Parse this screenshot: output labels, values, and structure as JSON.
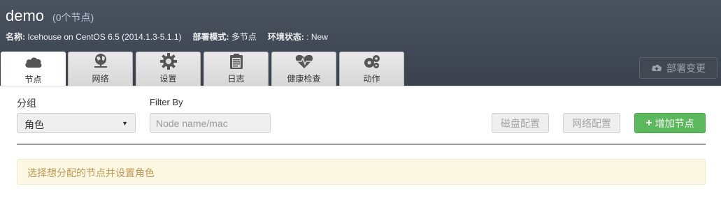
{
  "header": {
    "env_name": "demo",
    "node_count": "(0个节点)",
    "meta": [
      {
        "key": "名称:",
        "value": "Icehouse on CentOS 6.5 (2014.1.3-5.1.1)"
      },
      {
        "key": "部署模式:",
        "value": "多节点"
      },
      {
        "key": "环境状态:",
        "value": ": New"
      }
    ]
  },
  "tabs": [
    {
      "label": "节点",
      "icon": "cloud-icon",
      "active": true
    },
    {
      "label": "网络",
      "icon": "network-icon",
      "active": false
    },
    {
      "label": "设置",
      "icon": "gear-icon",
      "active": false
    },
    {
      "label": "日志",
      "icon": "clipboard-icon",
      "active": false
    },
    {
      "label": "健康检查",
      "icon": "heartbeat-icon",
      "active": false
    },
    {
      "label": "动作",
      "icon": "cogs-icon",
      "active": false
    }
  ],
  "deploy_button": {
    "label": "部署变更",
    "icon": "cloud-upload-icon"
  },
  "toolbar": {
    "group_label": "分组",
    "group_value": "角色",
    "filter_label": "Filter By",
    "filter_placeholder": "Node name/mac",
    "disk_config": "磁盘配置",
    "net_config": "网络配置",
    "add_node": "增加节点"
  },
  "notice": "选择想分配的节点并设置角色",
  "colors": {
    "accent_green": "#5cb85c",
    "background_dark": "#3b424e",
    "notice_bg": "#fcf8e3",
    "notice_text": "#c09853"
  }
}
